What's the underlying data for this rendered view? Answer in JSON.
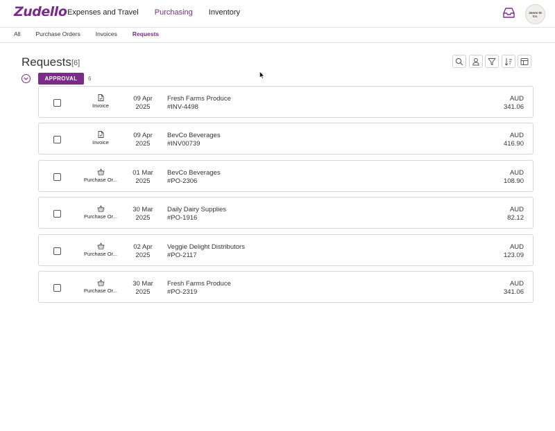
{
  "app": {
    "logo": "Zudello",
    "avatar_text": "Jones St Co."
  },
  "top_nav": [
    {
      "label": "Expenses and Travel",
      "active": false
    },
    {
      "label": "Purchasing",
      "active": true
    },
    {
      "label": "Inventory",
      "active": false
    }
  ],
  "sub_nav": [
    {
      "label": "All",
      "active": false
    },
    {
      "label": "Purchase Orders",
      "active": false
    },
    {
      "label": "Invoices",
      "active": false
    },
    {
      "label": "Requests",
      "active": true
    }
  ],
  "page": {
    "title": "Requests",
    "count": "[6]"
  },
  "group": {
    "label": "APPROVAL",
    "count": "6"
  },
  "colors": {
    "accent": "#7a2b8a"
  },
  "toolbar_icons": [
    "search-icon",
    "user-icon",
    "filter-icon",
    "sort-icon",
    "columns-icon"
  ],
  "rows": [
    {
      "type": "Invoice",
      "icon": "document-icon",
      "date_day": "09 Apr",
      "date_year": "2025",
      "vendor": "Fresh Farms Produce",
      "ref": "#INV-4498",
      "currency": "AUD",
      "amount": "341.06"
    },
    {
      "type": "Invoice",
      "icon": "document-icon",
      "date_day": "09 Apr",
      "date_year": "2025",
      "vendor": "BevCo Beverages",
      "ref": "#INV00739",
      "currency": "AUD",
      "amount": "416.90"
    },
    {
      "type": "Purchase Or...",
      "icon": "basket-icon",
      "date_day": "01 Mar",
      "date_year": "2025",
      "vendor": "BevCo Beverages",
      "ref": "#PO-2306",
      "currency": "AUD",
      "amount": "108.90"
    },
    {
      "type": "Purchase Or...",
      "icon": "basket-icon",
      "date_day": "30 Mar",
      "date_year": "2025",
      "vendor": "Daily Dairy Supplies",
      "ref": "#PO-1916",
      "currency": "AUD",
      "amount": "82.12"
    },
    {
      "type": "Purchase Or...",
      "icon": "basket-icon",
      "date_day": "02 Apr",
      "date_year": "2025",
      "vendor": "Veggie Delight Distributors",
      "ref": "#PO-2117",
      "currency": "AUD",
      "amount": "123.09"
    },
    {
      "type": "Purchase Or...",
      "icon": "basket-icon",
      "date_day": "30 Mar",
      "date_year": "2025",
      "vendor": "Fresh Farms Produce",
      "ref": "#PO-2319",
      "currency": "AUD",
      "amount": "341.06"
    }
  ]
}
